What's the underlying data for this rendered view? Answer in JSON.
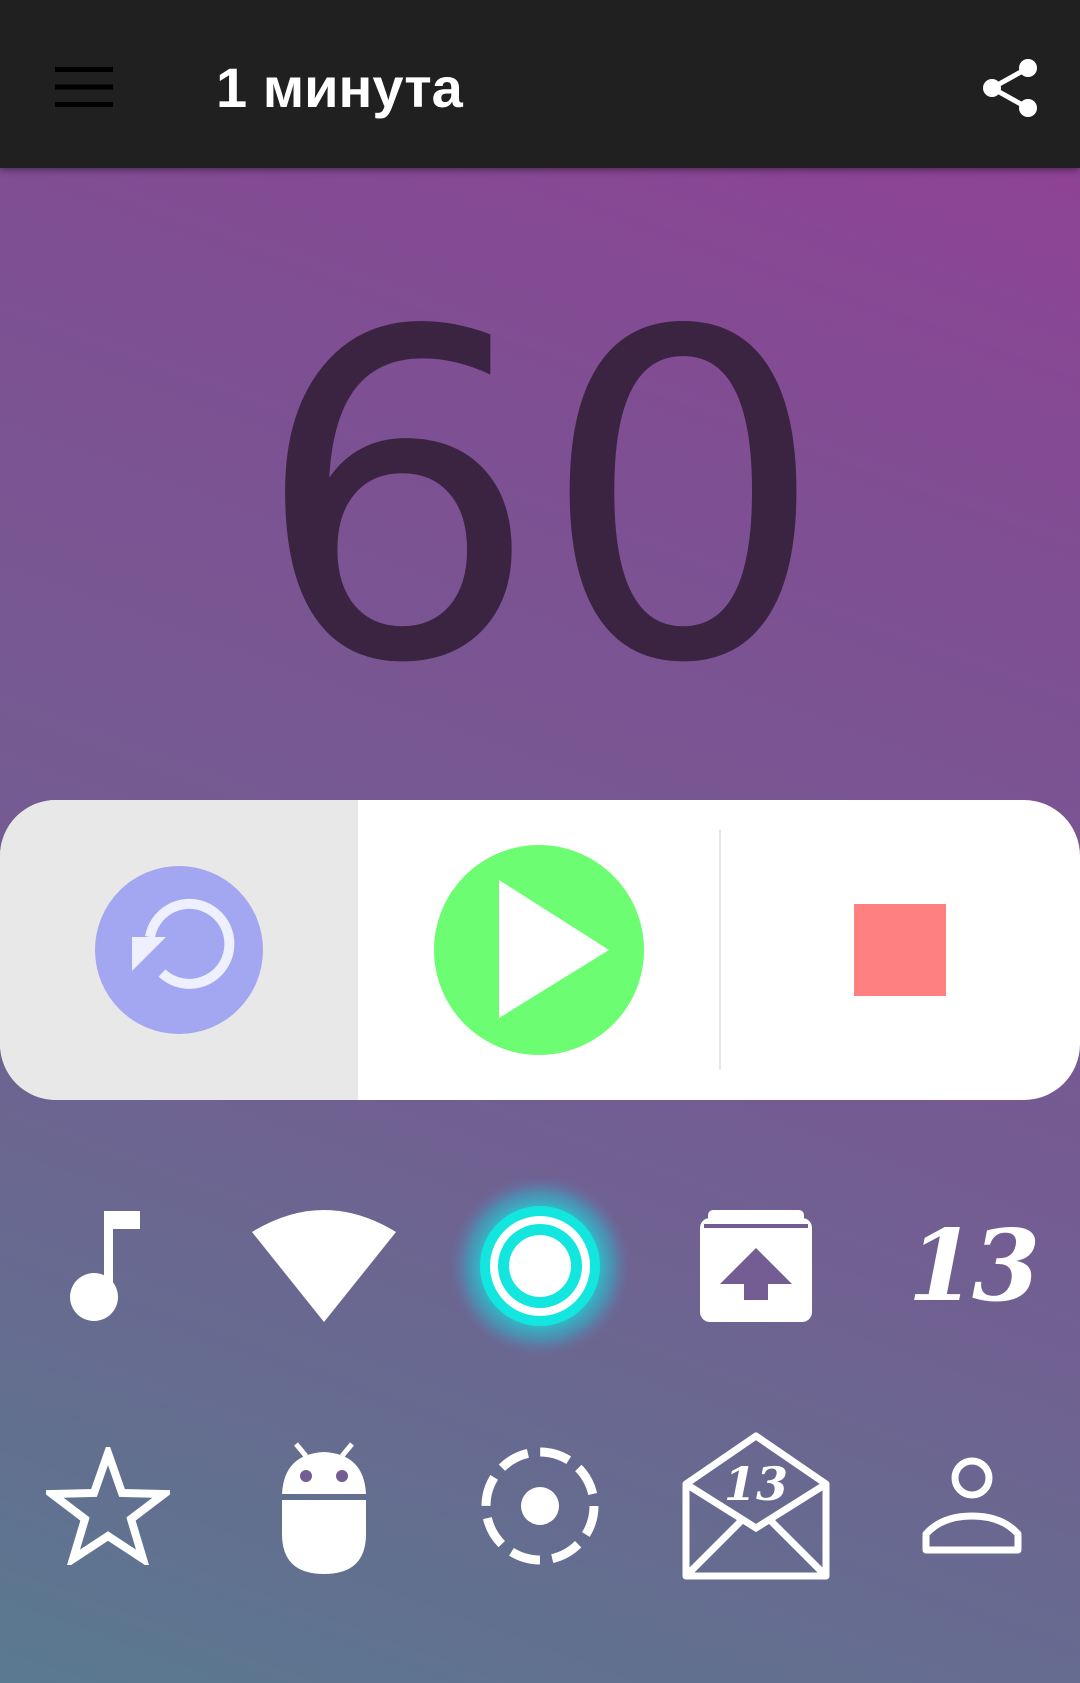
{
  "appbar": {
    "title": "1 минута",
    "menu_icon": "hamburger-menu-icon",
    "share_icon": "share-icon"
  },
  "timer": {
    "value": "60"
  },
  "controls": {
    "reset_icon": "replay-icon",
    "play_icon": "play-icon",
    "stop_icon": "stop-icon",
    "colors": {
      "reset": "#a3a6f0",
      "play": "#6dfd73",
      "stop": "#ff8080"
    }
  },
  "icons": {
    "row1": [
      "music-note-icon",
      "wifi-signal-icon",
      "radio-target-icon",
      "archive-upload-icon",
      "number-13-icon"
    ],
    "row1_number_label": "13",
    "row2": [
      "star-outline-icon",
      "android-icon",
      "dashed-circle-icon",
      "mail-13-icon",
      "person-outline-icon"
    ],
    "mail_badge_label": "13"
  },
  "colors": {
    "appbar": "#202020",
    "timer_text": "#3a2442",
    "accent_cyan": "#13e6df"
  }
}
